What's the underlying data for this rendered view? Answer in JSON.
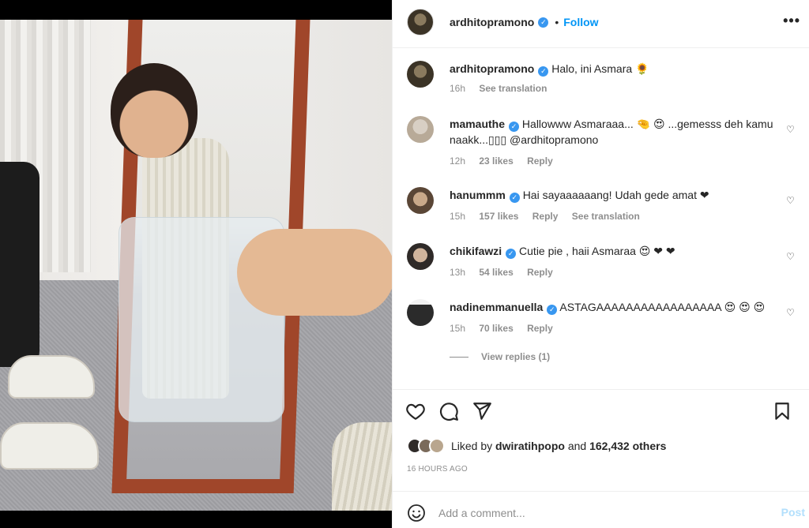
{
  "post": {
    "username": "ardhitopramono",
    "follow_label": "Follow",
    "more_label": "•••",
    "dot": "•"
  },
  "caption": {
    "username": "ardhitopramono",
    "text": "Halo, ini Asmara 🌻",
    "time": "16h",
    "see_translation": "See translation"
  },
  "comments": [
    {
      "username": "mamauthe",
      "text": "Hallowww Asmaraaa... 🤏 😍 ...gemesss deh kamu naakk...▯▯▯ @ardhitopramono",
      "time": "12h",
      "likes": "23 likes",
      "reply": "Reply"
    },
    {
      "username": "hanummm",
      "text": "Hai sayaaaaaang! Udah gede amat ❤",
      "time": "15h",
      "likes": "157 likes",
      "reply": "Reply",
      "see_translation": "See translation"
    },
    {
      "username": "chikifawzi",
      "text": "Cutie pie , haii Asmaraa 😍 ❤ ❤",
      "time": "13h",
      "likes": "54 likes",
      "reply": "Reply"
    },
    {
      "username": "nadinemmanuella",
      "text": "ASTAGAAAAAAAAAAAAAAAAA 😍 😍 😍",
      "time": "15h",
      "likes": "70 likes",
      "reply": "Reply"
    }
  ],
  "view_replies": "View replies (1)",
  "liked_by": {
    "prefix": "Liked by",
    "user": "dwiratihpopo",
    "and": "and",
    "others": "162,432 others"
  },
  "timestamp": "16 HOURS AGO",
  "add_comment": {
    "placeholder": "Add a comment...",
    "post_label": "Post"
  },
  "colors": {
    "accent": "#0095f6",
    "verified": "#3897f0",
    "muted": "#8e8e8e",
    "heart": "#ed4956"
  }
}
